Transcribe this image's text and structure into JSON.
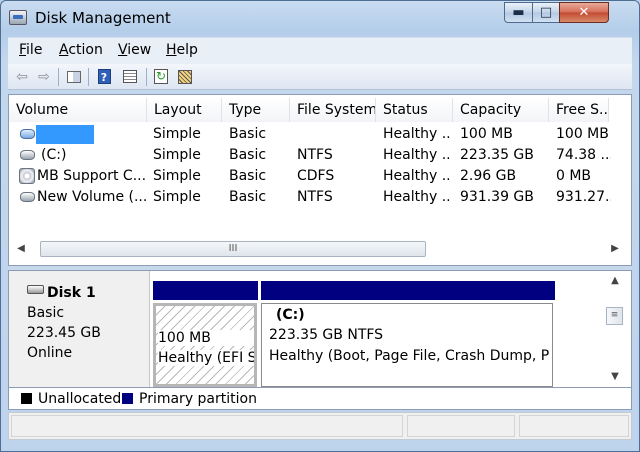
{
  "window": {
    "title": "Disk Management",
    "min_glyph": "▬",
    "max_glyph": "□",
    "close_glyph": "✕"
  },
  "menu": [
    {
      "label_ul": "F",
      "label_rest": "ile"
    },
    {
      "label_ul": "A",
      "label_rest": "ction"
    },
    {
      "label_ul": "V",
      "label_rest": "iew"
    },
    {
      "label_ul": "H",
      "label_rest": "elp"
    }
  ],
  "toolbar": {
    "back_icon": "⇦",
    "forward_icon": "⇨",
    "help_glyph": "?",
    "refresh_glyph": "↻"
  },
  "volume_list": {
    "columns": [
      "Volume",
      "Layout",
      "Type",
      "File System",
      "Status",
      "Capacity",
      "Free S..."
    ],
    "rows": [
      {
        "volume": "",
        "layout": "Simple",
        "type": "Basic",
        "fs": "",
        "status": "Healthy ...",
        "capacity": "100 MB",
        "free": "100 MB",
        "icon": "disk-icon"
      },
      {
        "volume": "(C:)",
        "layout": "Simple",
        "type": "Basic",
        "fs": "NTFS",
        "status": "Healthy ...",
        "capacity": "223.35 GB",
        "free": "74.38 ...",
        "icon": "disk-icon"
      },
      {
        "volume": "MB Support C...",
        "layout": "Simple",
        "type": "Basic",
        "fs": "CDFS",
        "status": "Healthy ...",
        "capacity": "2.96 GB",
        "free": "0 MB",
        "icon": "cd-drive-icon"
      },
      {
        "volume": "New Volume (...",
        "layout": "Simple",
        "type": "Basic",
        "fs": "NTFS",
        "status": "Healthy ...",
        "capacity": "931.39 GB",
        "free": "931.27...",
        "icon": "disk-icon"
      }
    ],
    "scroll_grip": "III"
  },
  "disk": {
    "name": "Disk 1",
    "type": "Basic",
    "size": "223.45 GB",
    "state": "Online",
    "partitions": [
      {
        "title": "",
        "line1": "100 MB",
        "line2": "Healthy (EFI Sy"
      },
      {
        "title": "(C:)",
        "line1": "223.35 GB NTFS",
        "line2": "Healthy (Boot, Page File, Crash Dump, Prin"
      }
    ]
  },
  "legend": [
    {
      "label": "Unallocated",
      "color": "#000000"
    },
    {
      "label": "Primary partition",
      "color": "#000080"
    }
  ],
  "colors": {
    "primary_partition": "#000080",
    "selection": "#3399ff"
  }
}
